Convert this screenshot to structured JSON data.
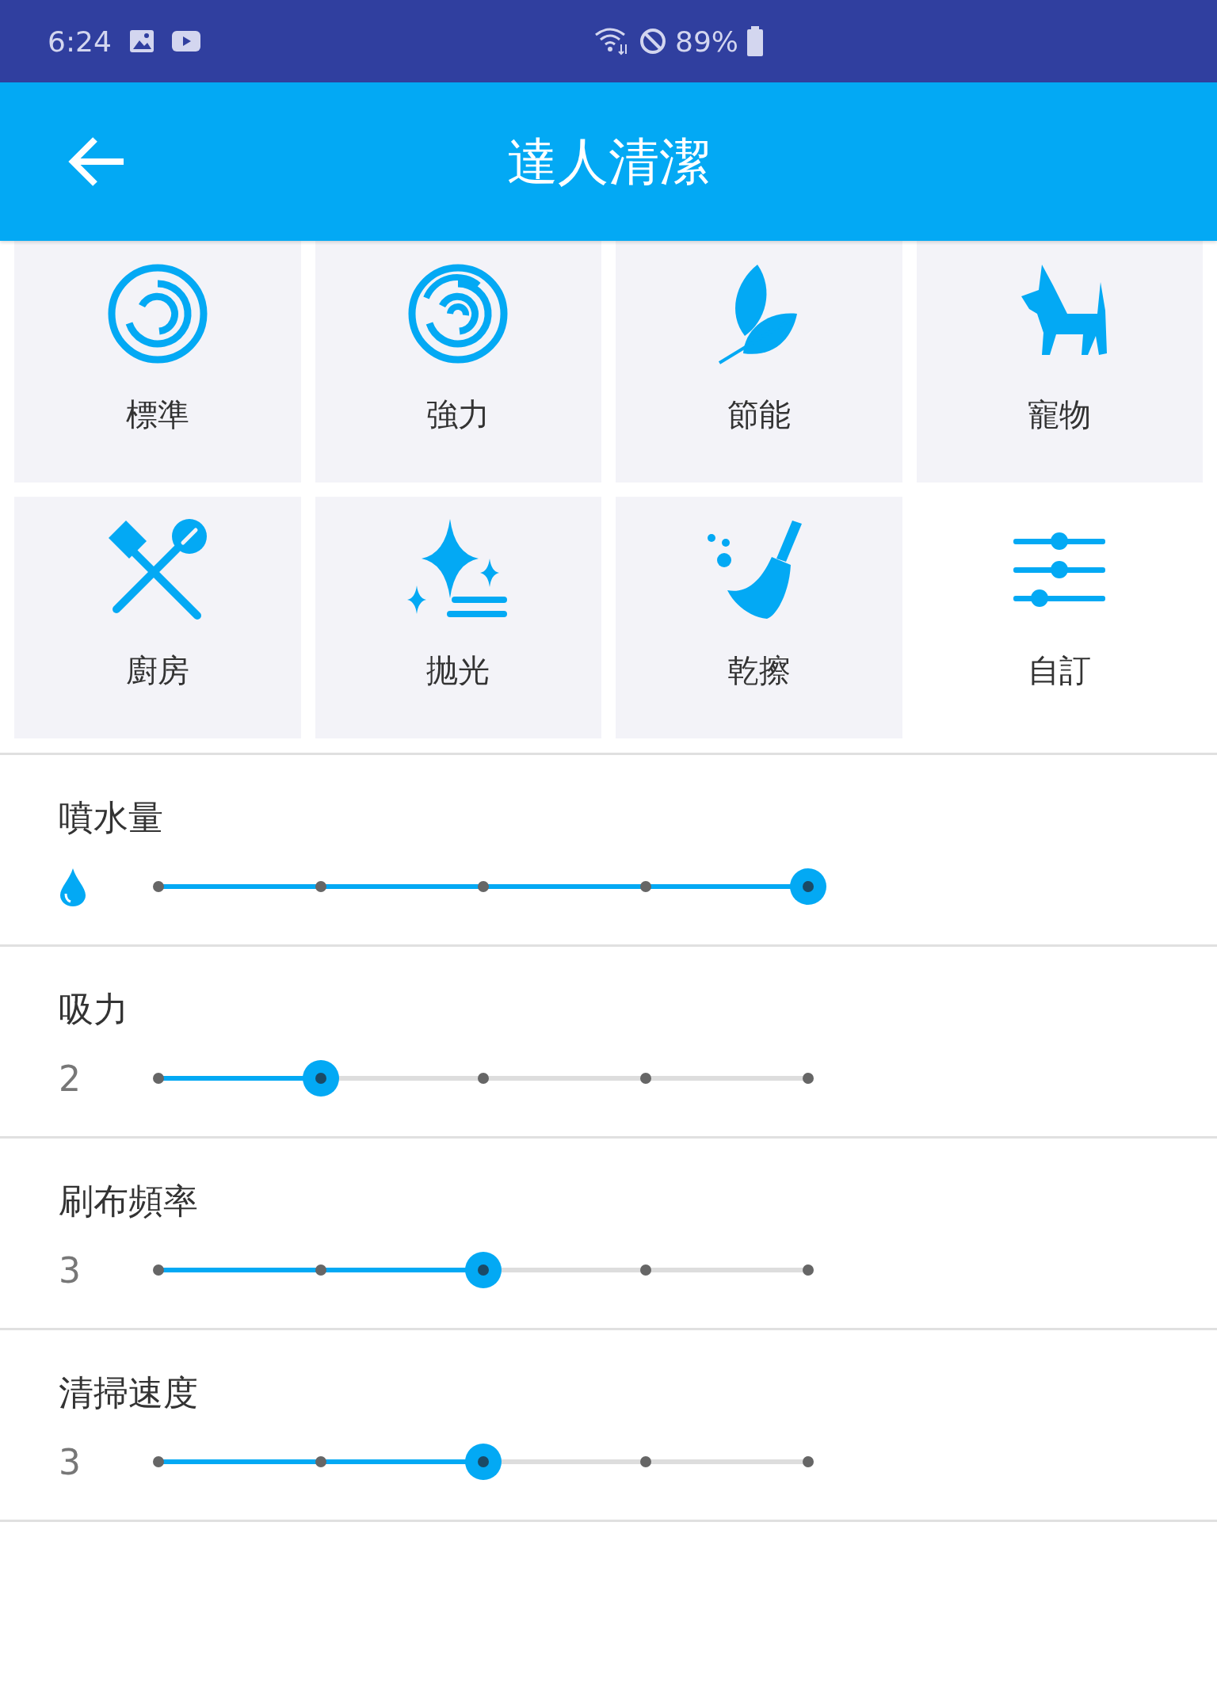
{
  "status_bar": {
    "time": "6:24",
    "battery": "89%"
  },
  "app_bar": {
    "title": "達人清潔"
  },
  "modes": [
    {
      "label": "標準",
      "kind": "preset"
    },
    {
      "label": "強力",
      "kind": "preset"
    },
    {
      "label": "節能",
      "kind": "preset"
    },
    {
      "label": "寵物",
      "kind": "preset"
    },
    {
      "label": "廚房",
      "kind": "preset"
    },
    {
      "label": "抛光",
      "kind": "preset"
    },
    {
      "label": "乾擦",
      "kind": "preset"
    },
    {
      "label": "自訂",
      "kind": "custom"
    }
  ],
  "settings": [
    {
      "label": "噴水量",
      "kind": "water",
      "level": 1
    },
    {
      "label": "吸力",
      "kind": "value",
      "reading": "2",
      "level": 0.25
    },
    {
      "label": "刷布頻率",
      "kind": "value",
      "reading": "3",
      "level": 0.5
    },
    {
      "label": "清掃速度",
      "kind": "value",
      "reading": "3",
      "level": 0.5
    }
  ]
}
